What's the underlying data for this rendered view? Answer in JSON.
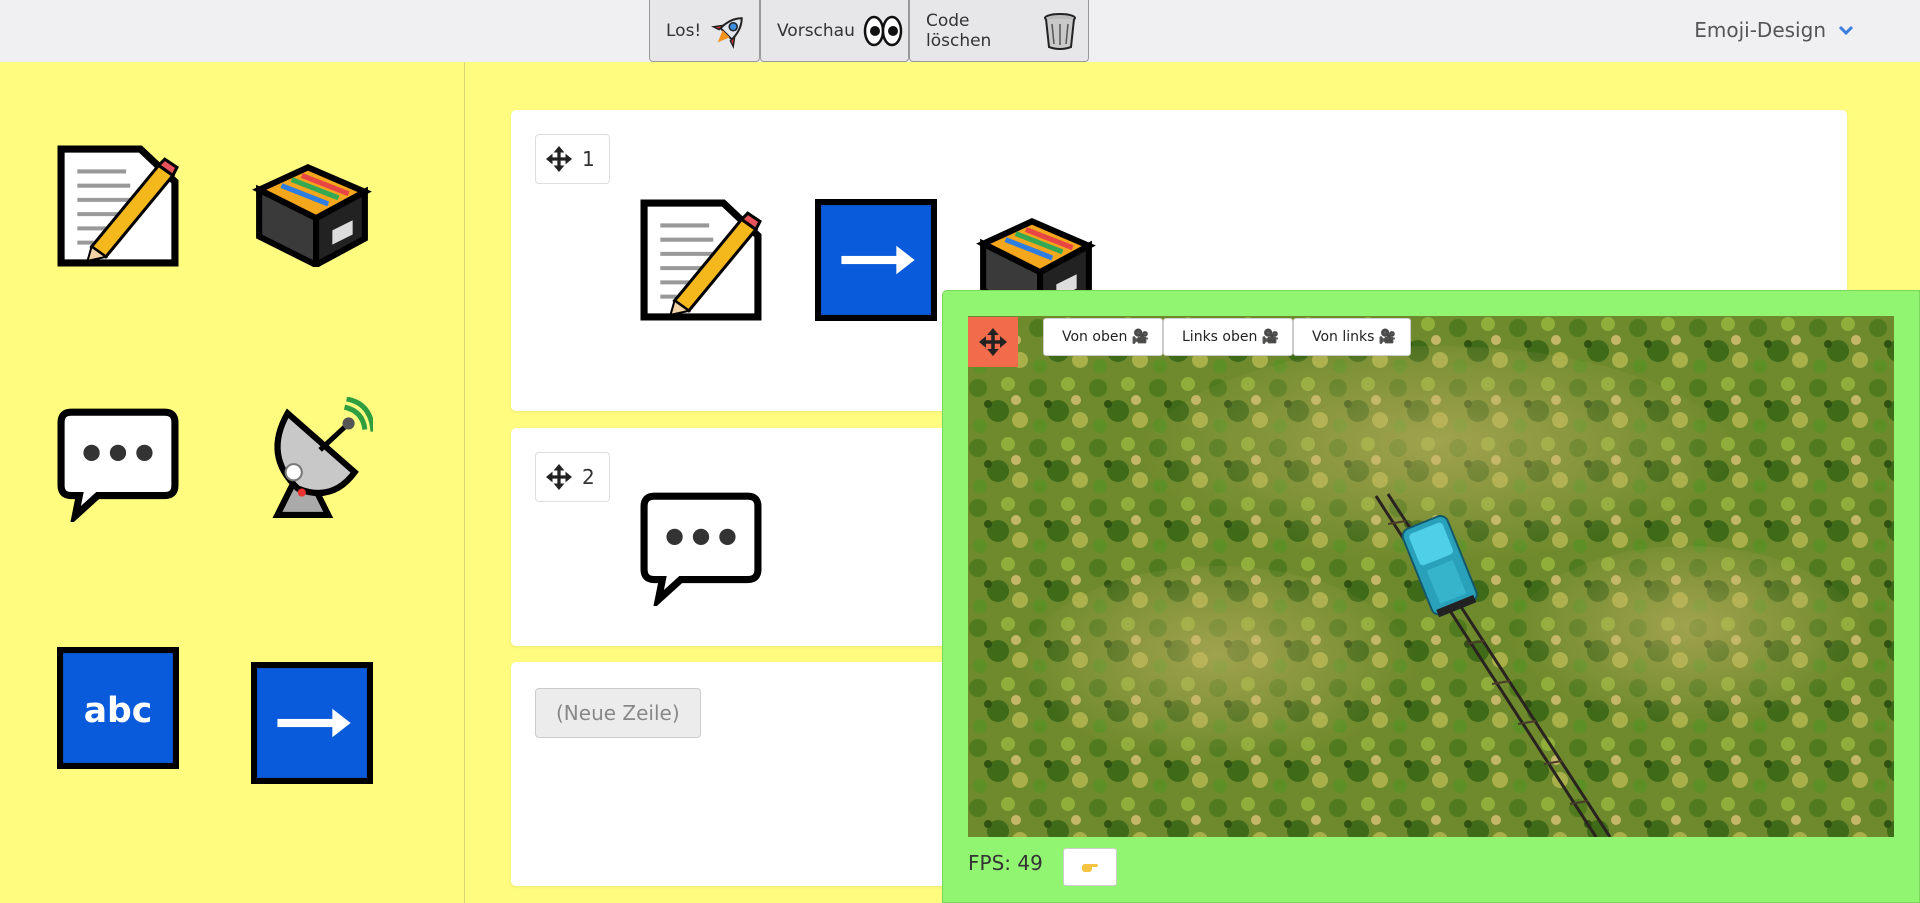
{
  "toolbar": {
    "run_label": "Los!",
    "preview_label": "Vorschau",
    "clear_label": "Code löschen",
    "design_label": "Emoji-Design"
  },
  "palette": {
    "items": [
      "memo-pencil-icon",
      "card-file-box-icon",
      "speech-bubble-icon",
      "satellite-antenna-icon",
      "abc-input-icon",
      "right-arrow-icon"
    ]
  },
  "rows": [
    {
      "number": "1",
      "blocks": [
        "memo-pencil-icon",
        "right-arrow-icon",
        "card-file-box-icon"
      ]
    },
    {
      "number": "2",
      "blocks": [
        "speech-bubble-icon"
      ]
    }
  ],
  "new_row_label": "(Neue Zeile)",
  "preview": {
    "camera_buttons": [
      "Von oben 🎥",
      "Links oben 🎥",
      "Von links 🎥"
    ],
    "fps_text": "FPS: 49"
  },
  "colors": {
    "background": "#fffc7f",
    "preview_panel": "#92f572",
    "move_button": "#f26b4a",
    "block_blue": "#0a5bdb",
    "train": "#38b6cf"
  }
}
